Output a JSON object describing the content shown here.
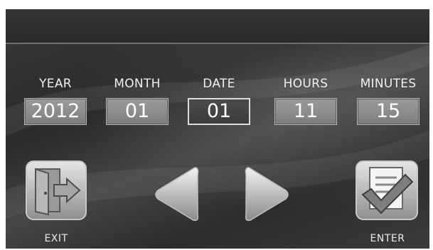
{
  "fields": [
    {
      "label": "YEAR",
      "value": "2012"
    },
    {
      "label": "MONTH",
      "value": "01"
    },
    {
      "label": "DATE",
      "value": "01"
    },
    {
      "label": "HOURS",
      "value": "11"
    },
    {
      "label": "MINUTES",
      "value": "15"
    }
  ],
  "selected_field": "DATE",
  "buttons": {
    "exit_label": "EXIT",
    "enter_label": "ENTER",
    "prev_icon": "left-arrow-icon",
    "next_icon": "right-arrow-icon",
    "exit_icon": "exit-door-icon",
    "enter_icon": "checkmark-document-icon"
  }
}
